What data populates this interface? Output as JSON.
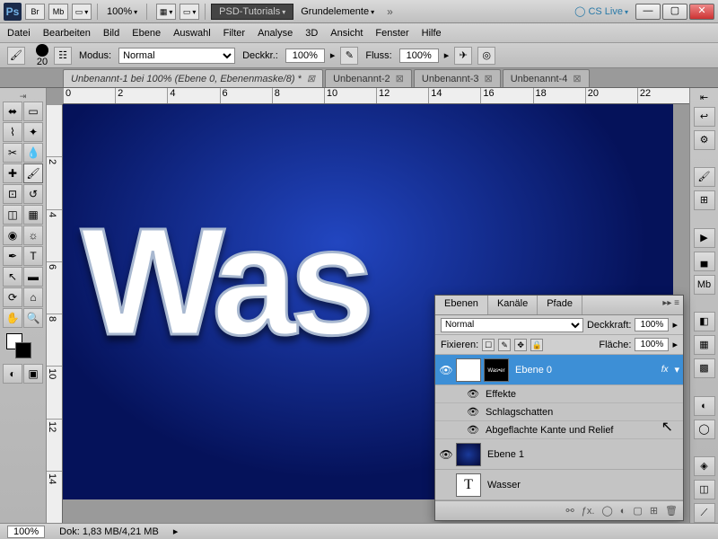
{
  "title": {
    "ps": "Ps",
    "br": "Br",
    "mb": "Mb",
    "zoom": "100%",
    "brand": "PSD-Tutorials",
    "doc": "Grundelemente",
    "cslive": "CS Live"
  },
  "menu": [
    "Datei",
    "Bearbeiten",
    "Bild",
    "Ebene",
    "Auswahl",
    "Filter",
    "Analyse",
    "3D",
    "Ansicht",
    "Fenster",
    "Hilfe"
  ],
  "opt": {
    "size": "20",
    "modus_lbl": "Modus:",
    "modus": "Normal",
    "deck_lbl": "Deckkr.:",
    "deck": "100%",
    "fluss_lbl": "Fluss:",
    "fluss": "100%"
  },
  "tabs": [
    {
      "label": "Unbenannt-1 bei 100% (Ebene 0, Ebenenmaske/8) *",
      "active": true
    },
    {
      "label": "Unbenannt-2",
      "active": false
    },
    {
      "label": "Unbenannt-3",
      "active": false
    },
    {
      "label": "Unbenannt-4",
      "active": false
    }
  ],
  "ruler_h": [
    "0",
    "2",
    "4",
    "6",
    "8",
    "10",
    "12",
    "14",
    "16",
    "18",
    "20",
    "22"
  ],
  "ruler_v": [
    "",
    "2",
    "4",
    "6",
    "8",
    "10",
    "12",
    "14"
  ],
  "canvas_text": "Was",
  "layers_panel": {
    "tabs": [
      "Ebenen",
      "Kanäle",
      "Pfade"
    ],
    "blend": "Normal",
    "deck_lbl": "Deckkraft:",
    "deck": "100%",
    "fix_lbl": "Fixieren:",
    "flaeche_lbl": "Fläche:",
    "flaeche": "100%",
    "layers": [
      {
        "name": "Ebene 0",
        "sel": true,
        "fx": "fx",
        "mask": true
      },
      {
        "name": "Ebene 1",
        "blue": true
      },
      {
        "name": "Wasser",
        "type": "T"
      }
    ],
    "effects": {
      "title": "Effekte",
      "items": [
        "Schlagschatten",
        "Abgeflachte Kante und Relief"
      ]
    }
  },
  "status": {
    "zoom": "100%",
    "dok": "Dok: 1,83 MB/4,21 MB"
  }
}
